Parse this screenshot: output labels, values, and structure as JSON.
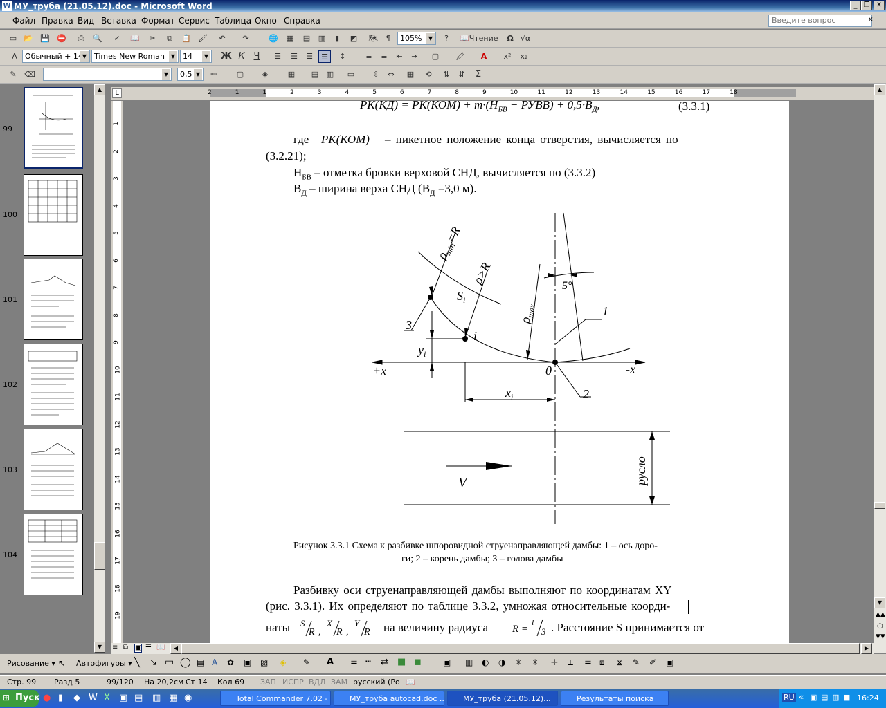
{
  "window": {
    "title": "МУ_труба (21.05.12).doc - Microsoft Word"
  },
  "menu": [
    "Файл",
    "Правка",
    "Вид",
    "Вставка",
    "Формат",
    "Сервис",
    "Таблица",
    "Окно",
    "Справка"
  ],
  "help_placeholder": "Введите вопрос",
  "toolbar": {
    "zoom": "105%",
    "reading": "Чтение"
  },
  "format": {
    "style": "Обычный + 14 г",
    "font": "Times New Roman",
    "size": "14"
  },
  "drawing_tb": {
    "line_weight": "0,5"
  },
  "thumbnails": [
    {
      "num": "99"
    },
    {
      "num": "100"
    },
    {
      "num": "101"
    },
    {
      "num": "102"
    },
    {
      "num": "103"
    },
    {
      "num": "104"
    }
  ],
  "ruler_h": [
    "2",
    "1",
    "1",
    "2",
    "3",
    "4",
    "5",
    "6",
    "7",
    "8",
    "9",
    "10",
    "11",
    "12",
    "13",
    "14",
    "15",
    "16",
    "17",
    "18"
  ],
  "ruler_v": [
    "1",
    "2",
    "3",
    "4",
    "5",
    "6",
    "7",
    "8",
    "9",
    "10",
    "11",
    "12",
    "13",
    "14",
    "15",
    "16",
    "17",
    "18",
    "19"
  ],
  "document": {
    "formula": "РК(КД) = РК(КОМ) + m·(H",
    "formula_sub": "БВ",
    "formula_rest": " − РУВВ) + 0,5·B",
    "formula_sub2": "Д",
    "formula_end": ",",
    "eq_num": "(3.3.1)",
    "p1a": "где",
    "p1b": "РК(КОМ)",
    "p1c": "– пикетное положение конца отверстия, вычисляется по",
    "p1d": "(3.2.21);",
    "p2": "Н",
    "p2sub": "БВ",
    "p2rest": " – отметка бровки верховой СНД, вычисляется по (3.3.2)",
    "p3": "В",
    "p3sub": "Д",
    "p3rest": " – ширина верха СНД (В",
    "p3sub2": "Д",
    "p3end": " =3,0 м).",
    "caption1": "Рисунок 3.3.1 Схема к разбивке шпоровидной струенаправляющей дамбы: 1 – ось доро-",
    "caption2": "ги; 2 – корень дамбы; 3 – голова дамбы",
    "p4": "Разбивку оси струенаправляющей дамбы выполняют по координатам XY",
    "p5": "(рис. 3.3.1). Их определяют по таблице 3.3.2, умножая относительные коорди-",
    "p6a": "наты",
    "p6b": "на величину радиуса",
    "p6c": ". Расстояние S принимается от"
  },
  "figure": {
    "rmin": "ρ",
    "rmin_sub": "min",
    "rmin_rest": "=R",
    "rgt": "ρ>R",
    "si": "S",
    "si_sub": "i",
    "angle": "5°",
    "pmax": "ρ",
    "pmax_sub": "max",
    "l1": "1",
    "l2": "2",
    "l3": "3",
    "i": "i",
    "yi": "y",
    "yi_sub": "i",
    "xi": "x",
    "xi_sub": "i",
    "plusx": "+x",
    "minusx": "-x",
    "zero": "0",
    "ruslo": "русло",
    "v": "V"
  },
  "statusbar": {
    "page": "Стр. 99",
    "section": "Разд 5",
    "count": "99/120",
    "at": "На 20,2см",
    "line": "Ст 14",
    "col": "Кол 69",
    "rec": "ЗАП",
    "trk": "ИСПР",
    "ext": "ВДЛ",
    "ovr": "ЗАМ",
    "lang": "русский (Ро"
  },
  "drawbar": {
    "draw": "Рисование",
    "autoshapes": "Автофигуры"
  },
  "taskbar": {
    "start": "Пуск",
    "tasks": [
      "Total Commander 7.02 - ...",
      "МУ_труба autocad.doc ...",
      "МУ_труба (21.05.12)...",
      "Результаты поиска"
    ],
    "lang": "RU",
    "clock": "16:24"
  }
}
